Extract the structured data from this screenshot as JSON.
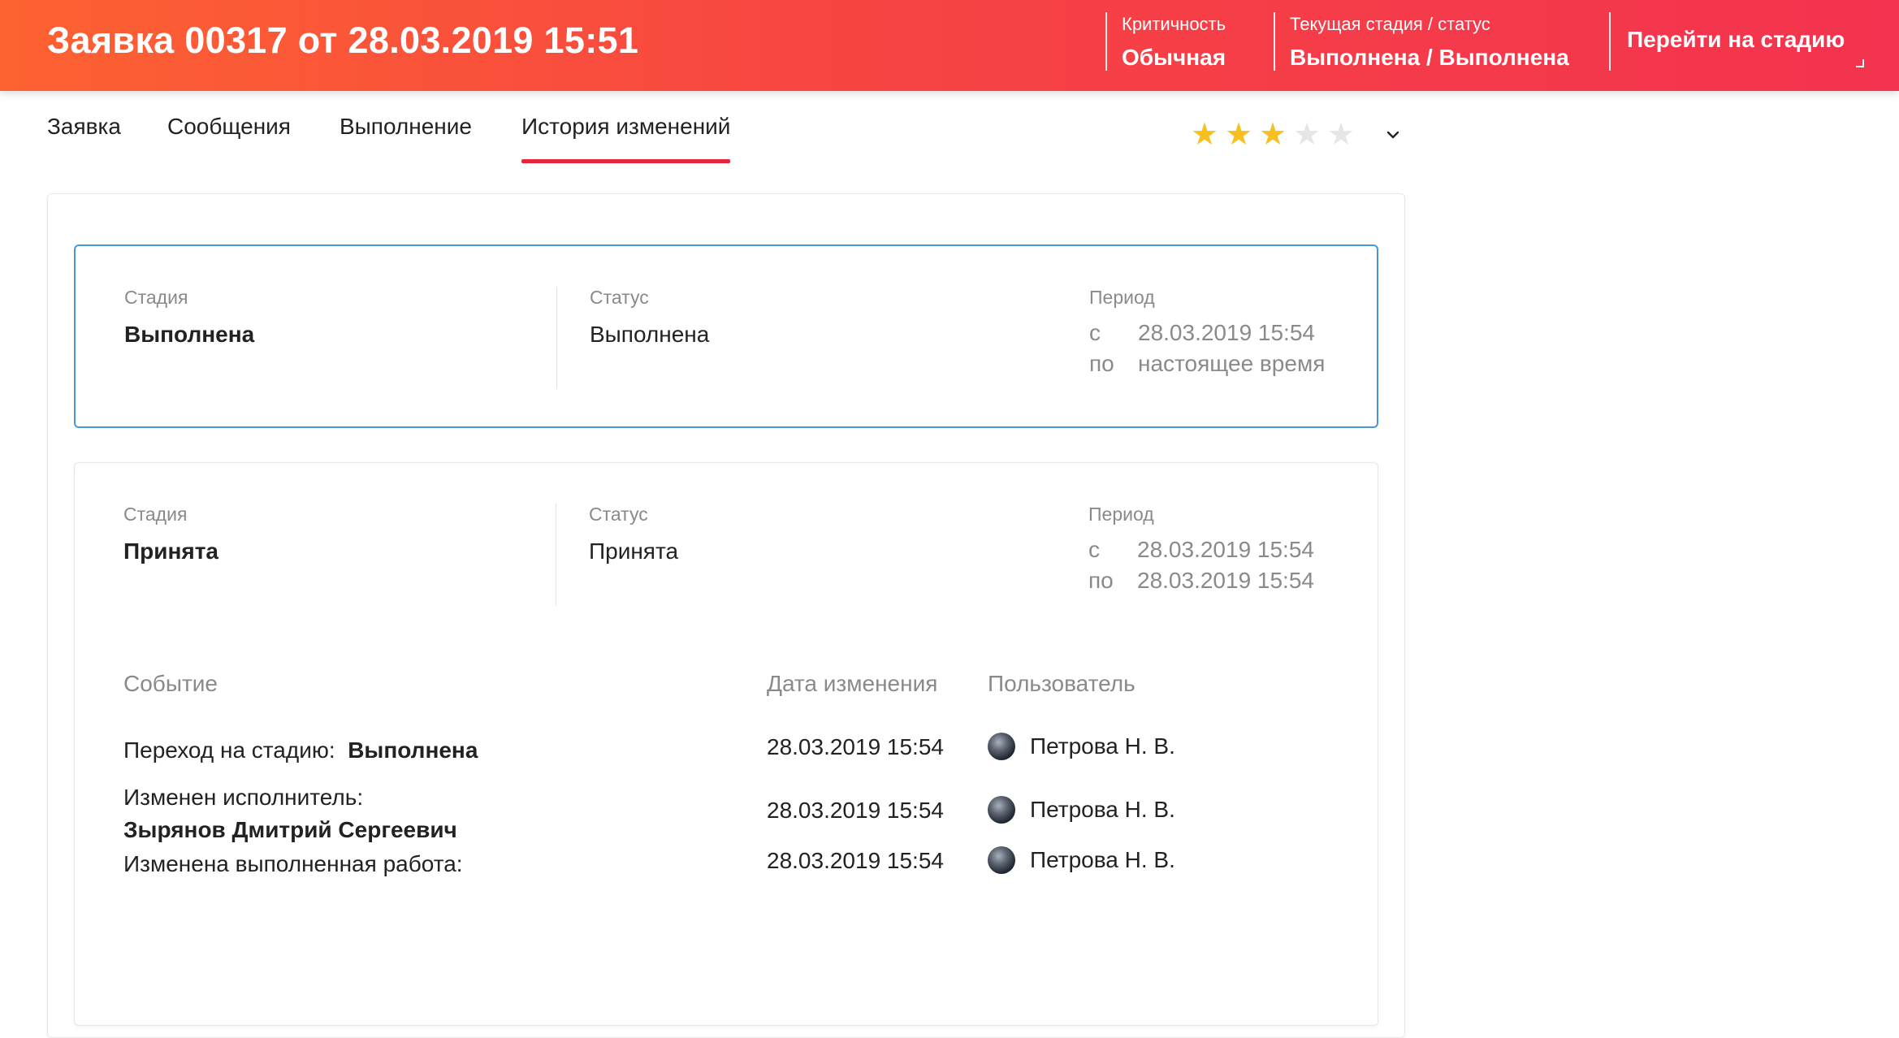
{
  "header": {
    "title": "Заявка 00317 от 28.03.2019 15:51",
    "criticality_label": "Критичность",
    "criticality_value": "Обычная",
    "stage_label": "Текущая стадия / статус",
    "stage_value": "Выполнена / Выполнена",
    "goto_label": "Перейти на стадию"
  },
  "tabs": [
    {
      "label": "Заявка",
      "active": false
    },
    {
      "label": "Сообщения",
      "active": false
    },
    {
      "label": "Выполнение",
      "active": false
    },
    {
      "label": "История изменений",
      "active": true
    }
  ],
  "rating": {
    "value": 3,
    "max": 5
  },
  "colors": {
    "accent": "#e7263c",
    "header_from": "#fd6231",
    "header_to": "#f3334f",
    "active_border": "#4a97d7",
    "star_on": "#f6c021",
    "star_off": "#e6e6e6"
  },
  "history": [
    {
      "stage_label": "Стадия",
      "stage": "Выполнена",
      "status_label": "Статус",
      "status": "Выполнена",
      "period_label": "Период",
      "from_label": "с",
      "from": "28.03.2019 15:54",
      "to_label": "по",
      "to": "настоящее время"
    },
    {
      "stage_label": "Стадия",
      "stage": "Принята",
      "status_label": "Статус",
      "status": "Принята",
      "period_label": "Период",
      "from_label": "с",
      "from": "28.03.2019 15:54",
      "to_label": "по",
      "to": "28.03.2019 15:54",
      "events_header": {
        "event": "Событие",
        "date": "Дата изменения",
        "user": "Пользователь"
      },
      "events": [
        {
          "text": "Переход на стадию:",
          "value": "Выполнена",
          "date": "28.03.2019 15:54",
          "user": "Петрова Н. В."
        },
        {
          "text": "Изменен исполнитель:",
          "value": "Зырянов Дмитрий Сергеевич",
          "date": "28.03.2019 15:54",
          "user": "Петрова Н. В."
        },
        {
          "text": "Изменена выполненная работа:",
          "value": "",
          "date": "28.03.2019 15:54",
          "user": "Петрова Н. В."
        }
      ]
    }
  ]
}
